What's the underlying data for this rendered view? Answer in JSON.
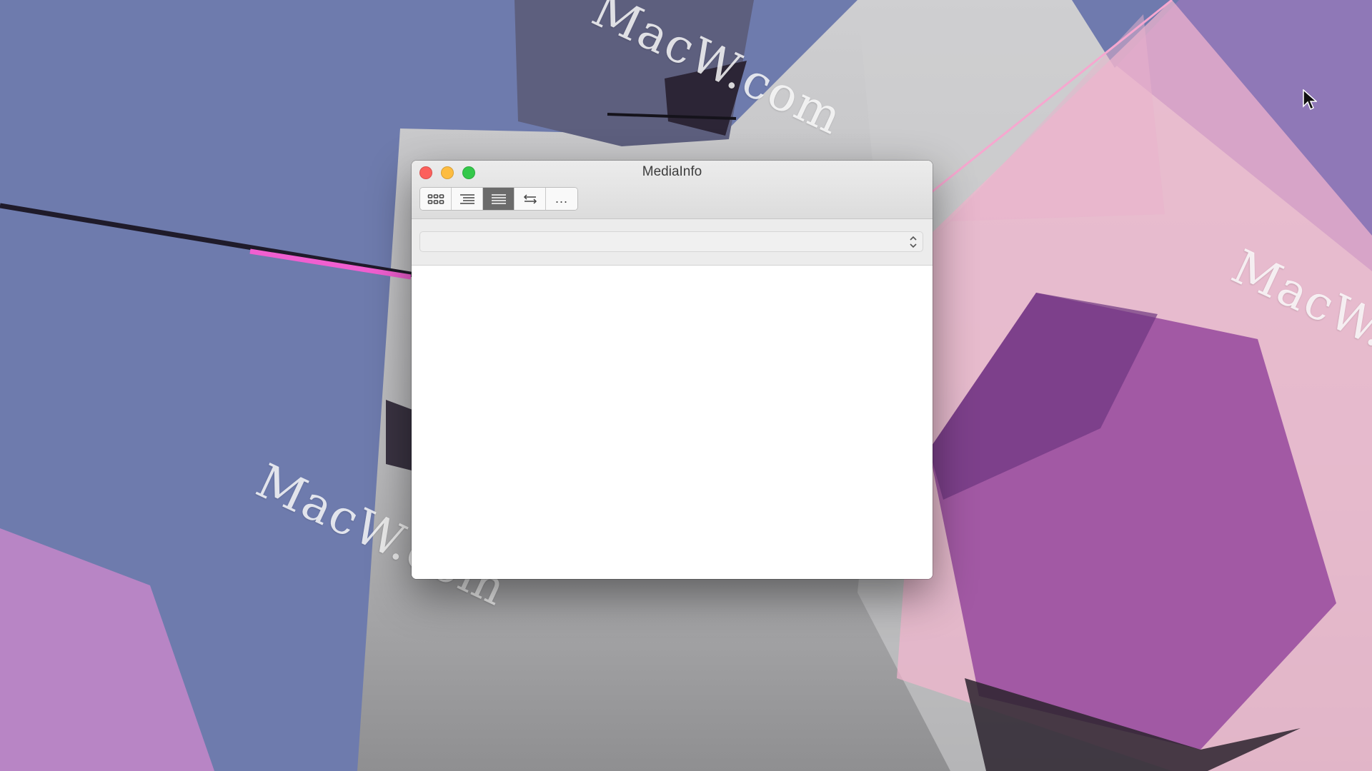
{
  "window": {
    "title": "MediaInfo"
  },
  "toolbar": {
    "views": [
      {
        "icon": "grid-view-icon",
        "active": false
      },
      {
        "icon": "tree-view-icon",
        "active": false
      },
      {
        "icon": "text-view-icon",
        "active": true
      },
      {
        "icon": "compare-arrows-icon",
        "active": false
      },
      {
        "icon": "more-icon",
        "label": "...",
        "active": false
      }
    ]
  },
  "file_selector": {
    "selected_value": ""
  },
  "watermarks": [
    "MacW.com",
    "MacW.com",
    "MacW.com"
  ],
  "colors": {
    "close": "#fc605c",
    "minimize": "#fdbc40",
    "maximize": "#34c84a",
    "active_view": "#6b6b6b"
  }
}
